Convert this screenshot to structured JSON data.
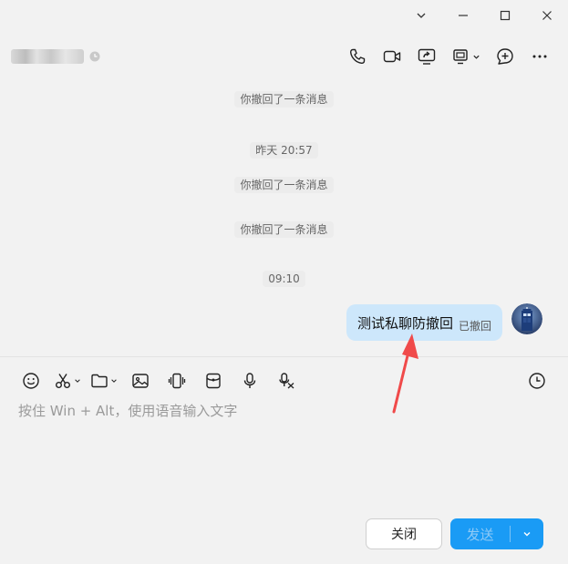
{
  "window": {
    "minimize_glyph": "⌄",
    "maximize_glyph": "☐",
    "close_glyph": "✕"
  },
  "header": {
    "contact_name_blurred": true,
    "tools": [
      "phone-icon",
      "video-icon",
      "screen-share-icon",
      "remote-desktop-icon",
      "add-chat-icon",
      "more-icon"
    ]
  },
  "chat": {
    "messages": [
      {
        "type": "system",
        "text": "你撤回了一条消息"
      },
      {
        "type": "time",
        "text": "昨天 20:57"
      },
      {
        "type": "system",
        "text": "你撤回了一条消息"
      },
      {
        "type": "system",
        "text": "你撤回了一条消息"
      },
      {
        "type": "time",
        "text": "09:10"
      }
    ],
    "outgoing": {
      "text": "测试私聊防撤回",
      "status": "已撤回"
    }
  },
  "input": {
    "placeholder": "按住 Win + Alt，使用语音输入文字",
    "tools": [
      "emoji-icon",
      "scissors-icon",
      "folder-icon",
      "image-icon",
      "vibrate-icon",
      "red-packet-icon",
      "mic-icon",
      "voice-to-text-icon",
      "history-icon"
    ]
  },
  "buttons": {
    "close_label": "关闭",
    "send_label": "发送"
  },
  "colors": {
    "accent": "#1a9bf5",
    "bubble": "#cde7fb",
    "annotation_arrow": "#f04a4a"
  }
}
